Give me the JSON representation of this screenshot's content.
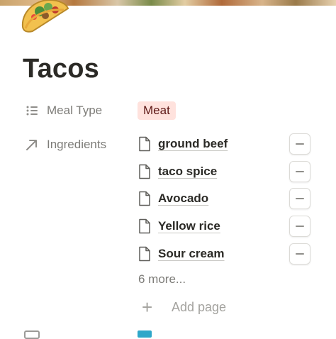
{
  "page": {
    "title": "Tacos",
    "icon": "taco-emoji"
  },
  "properties": {
    "meal_type": {
      "name": "Meal Type",
      "icon": "list-icon",
      "value": "Meat",
      "tag_color": "#ffe2dd"
    },
    "ingredients": {
      "name": "Ingredients",
      "icon": "relation-arrow-icon",
      "items": [
        {
          "label": "ground beef"
        },
        {
          "label": "taco spice"
        },
        {
          "label": "Avocado"
        },
        {
          "label": "Yellow rice"
        },
        {
          "label": "Sour cream"
        }
      ],
      "more_label": "6 more...",
      "add_label": "Add page",
      "add_icon": "+"
    }
  }
}
